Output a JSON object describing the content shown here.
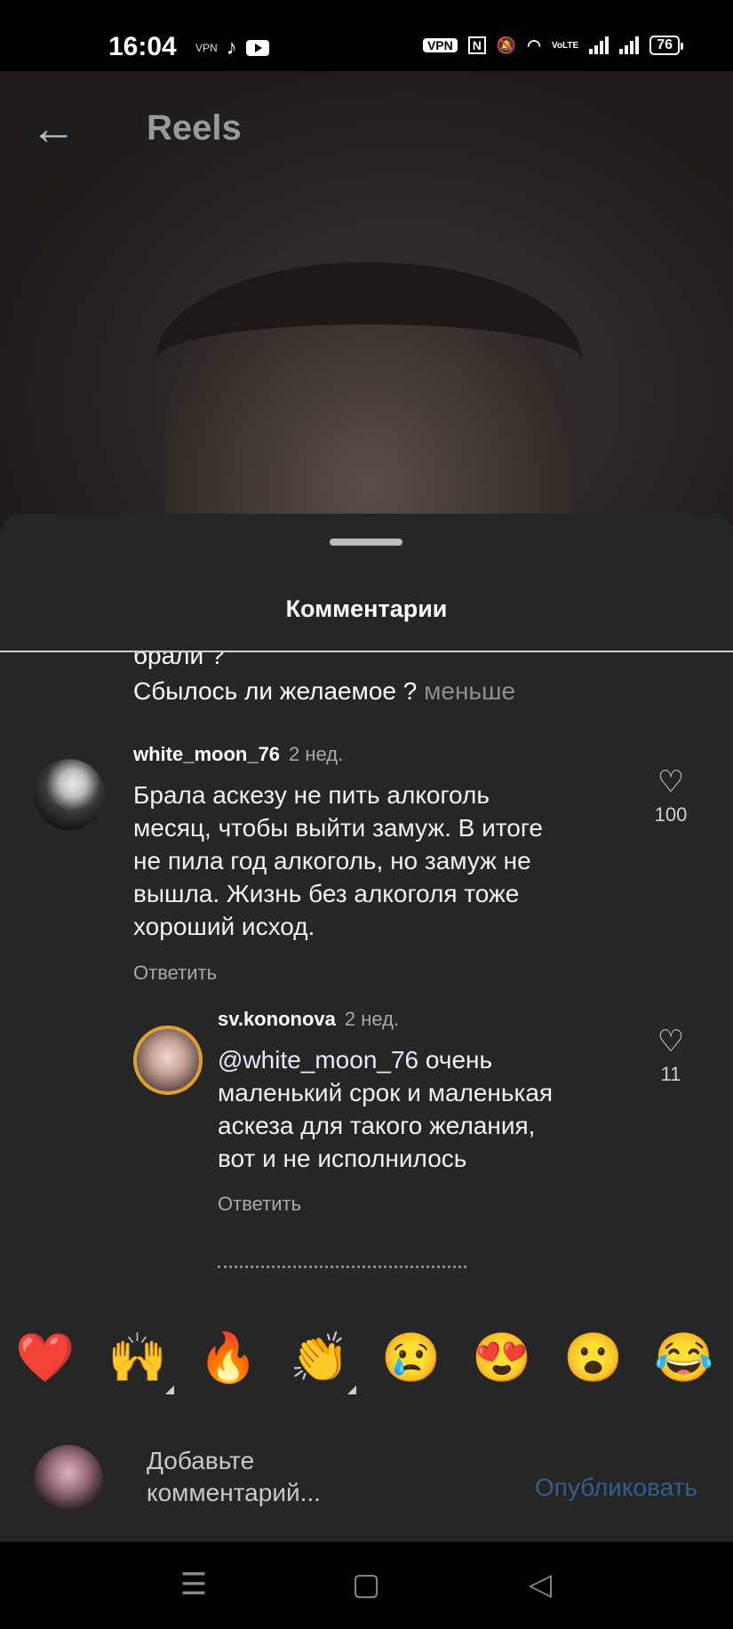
{
  "status_bar": {
    "time": "16:04",
    "left_icons": [
      "vpn-key-icon",
      "tiktok-icon",
      "youtube-icon"
    ],
    "vpn_label": "VPN",
    "nfc_label": "N",
    "volte_label": "VoLTE",
    "battery": "76"
  },
  "header": {
    "back_icon": "arrow-left-icon",
    "title": "Reels"
  },
  "sheet": {
    "title": "Комментарии",
    "truncated_line": "брали ?",
    "tail_line": "Сбылось ли желаемое ?",
    "less_label": "меньше",
    "comments": [
      {
        "username": "white_moon_76",
        "time": "2 нед.",
        "lines": [
          "Брала аскезу не пить алкоголь",
          "месяц, чтобы выйти замуж. В итоге",
          "не пила год алкоголь, но замуж не",
          "вышла. Жизнь без алкоголя тоже",
          "хороший исход."
        ],
        "reply_label": "Ответить",
        "likes": "100"
      },
      {
        "username": "sv.kononova",
        "time": "2 нед.",
        "mention": "@white_moon_76",
        "lines": [
          " очень",
          "маленький срок и маленькая",
          "аскеза для такого желания,",
          "вот и не исполнилось"
        ],
        "reply_label": "Ответить",
        "likes": "11"
      }
    ]
  },
  "emojis": [
    "❤️",
    "🙌",
    "🔥",
    "👏",
    "😢",
    "😍",
    "😮",
    "😂"
  ],
  "composer": {
    "placeholder_line1": "Добавьте",
    "placeholder_line2": "комментарий...",
    "publish_label": "Опубликовать"
  },
  "navbar": {
    "icons": [
      "menu-icon",
      "home-square-icon",
      "back-triangle-icon"
    ]
  },
  "colors": {
    "sheet_bg": "#262626",
    "publish_disabled": "#2f5f8a",
    "muted_text": "#a8a8a8"
  }
}
